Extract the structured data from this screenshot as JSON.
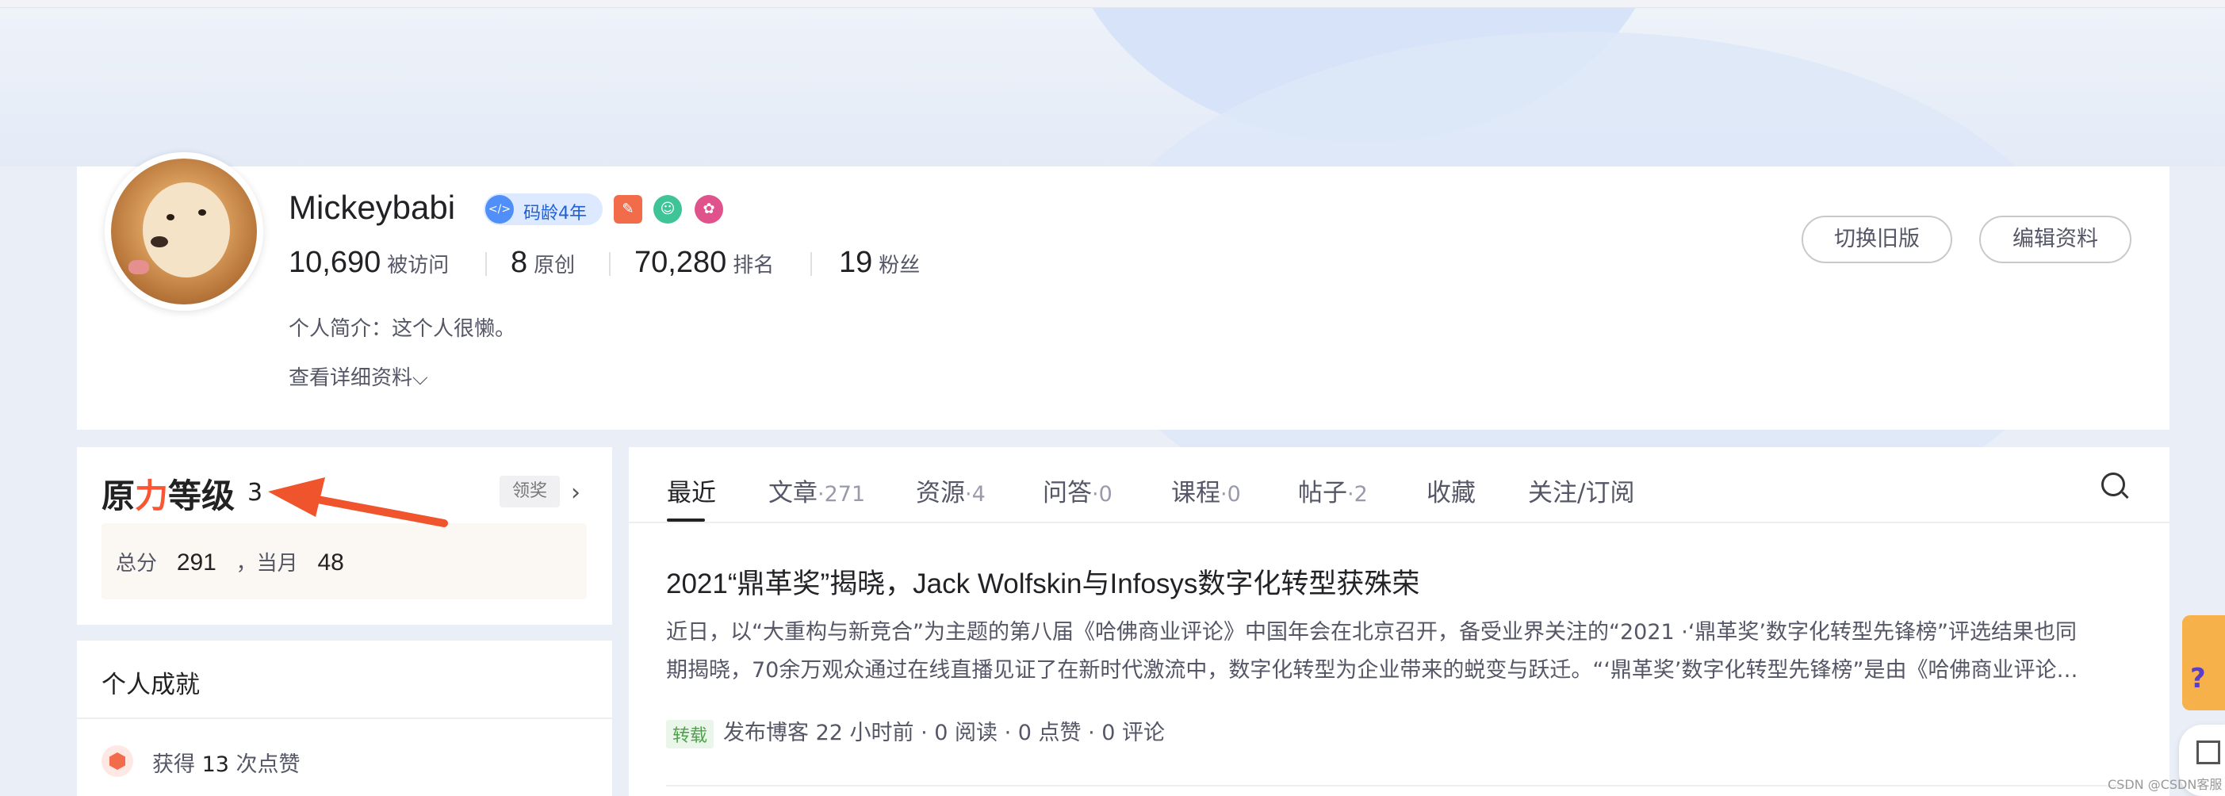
{
  "profile": {
    "username": "Mickeybabi",
    "code_age_badge": "码龄4年",
    "stats": [
      {
        "num": "10,690",
        "label": "被访问"
      },
      {
        "num": "8",
        "label": "原创"
      },
      {
        "num": "70,280",
        "label": "排名"
      },
      {
        "num": "19",
        "label": "粉丝"
      }
    ],
    "intro": "个人简介：这个人很懒。",
    "more_info": "查看详细资料",
    "buttons": {
      "switch": "切换旧版",
      "edit": "编辑资料"
    }
  },
  "level": {
    "title_a": "原",
    "title_b": "力",
    "title_c": "等级",
    "value": "3",
    "claim_btn": "领奖",
    "total_label": "总分",
    "total": "291",
    "sep": "，当月",
    "month": "48"
  },
  "achievements": {
    "title": "个人成就",
    "item_prefix": "获得",
    "item_count": "13",
    "item_suffix": "次点赞"
  },
  "tabs": [
    {
      "label": "最近",
      "count": ""
    },
    {
      "label": "文章",
      "count": "·271"
    },
    {
      "label": "资源",
      "count": "·4"
    },
    {
      "label": "问答",
      "count": "·0"
    },
    {
      "label": "课程",
      "count": "·0"
    },
    {
      "label": "帖子",
      "count": "·2"
    },
    {
      "label": "收藏",
      "count": ""
    },
    {
      "label": "关注/订阅",
      "count": ""
    }
  ],
  "article": {
    "title": "2021“鼎革奖”揭晓，Jack Wolfskin与Infosys数字化转型获殊荣",
    "desc_line1": "近日，以“大重构与新竞合”为主题的第八届《哈佛商业评论》中国年会在北京召开，备受业界关注的“2021 ·‘鼎革奖’数字化转型先锋榜”评选结果也同",
    "desc_line2": "期揭晓，70余万观众通过在线直播见证了在新时代激流中，数字化转型为企业带来的蜕变与跃迁。“‘鼎革奖’数字化转型先锋榜”是由《哈佛商业评论…",
    "tag": "转载",
    "meta": "发布博客 22 小时前 · 0 阅读 · 0 点赞 · 0 评论"
  },
  "watermark": "CSDN @CSDN客服",
  "colors": {
    "accent": "#fc5531",
    "arrow": "#f0542d"
  }
}
